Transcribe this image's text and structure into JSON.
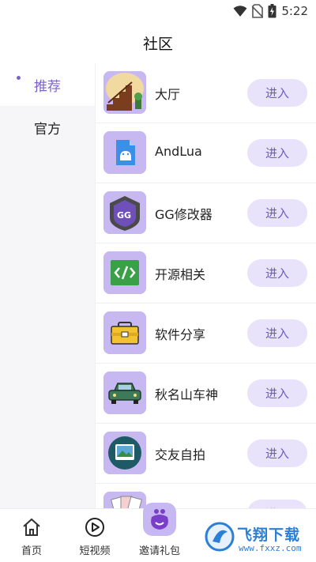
{
  "status": {
    "time": "5:22",
    "icons": [
      "wifi-icon",
      "no-sim-icon",
      "battery-charging-icon"
    ]
  },
  "header": {
    "title": "社区"
  },
  "sidebar": {
    "items": [
      {
        "label": "推荐",
        "active": true
      },
      {
        "label": "官方",
        "active": false
      }
    ]
  },
  "list": {
    "items": [
      {
        "label": "大厅",
        "icon": "lobby-stairs-icon",
        "button": "进入"
      },
      {
        "label": "AndLua",
        "icon": "android-file-icon",
        "button": "进入"
      },
      {
        "label": "GG修改器",
        "icon": "gg-modifier-icon",
        "button": "进入"
      },
      {
        "label": "开源相关",
        "icon": "code-brackets-icon",
        "button": "进入"
      },
      {
        "label": "软件分享",
        "icon": "toolbox-icon",
        "button": "进入"
      },
      {
        "label": "秋名山车神",
        "icon": "car-icon",
        "button": "进入"
      },
      {
        "label": "交友自拍",
        "icon": "photo-icon",
        "button": "进入"
      },
      {
        "label": "",
        "icon": "cards-icon",
        "button": "进入"
      }
    ]
  },
  "tabbar": {
    "items": [
      {
        "label": "首页",
        "icon": "home-icon"
      },
      {
        "label": "短视频",
        "icon": "play-circle-icon"
      },
      {
        "label": "邀请礼包",
        "icon": "gift-bag-icon"
      }
    ]
  },
  "watermark": {
    "text": "飞翔下载",
    "url": "www.fxxz.com"
  },
  "colors": {
    "accent": "#7a64c8",
    "icon_bg": "#c7b8f2",
    "button_bg": "#e8e2fa"
  }
}
